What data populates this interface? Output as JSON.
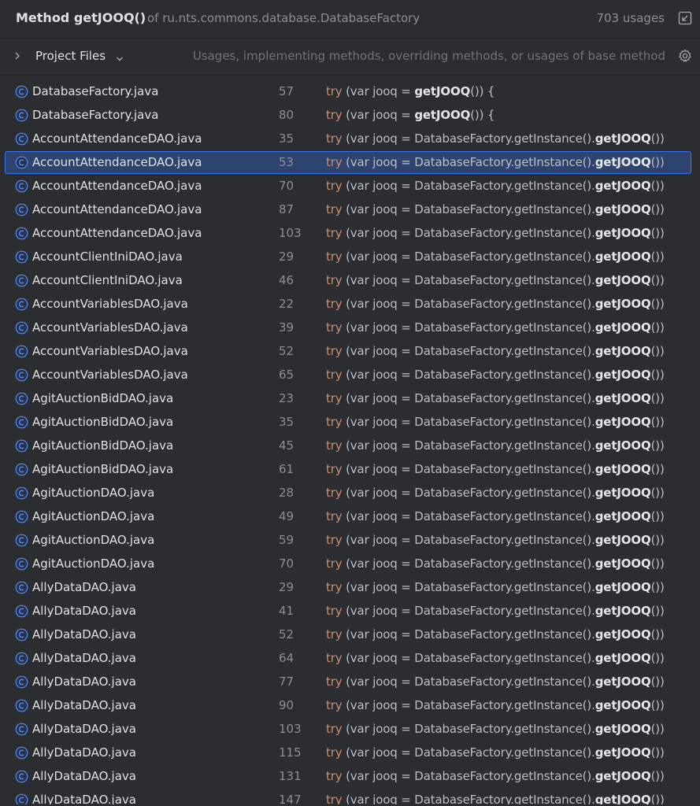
{
  "header": {
    "title": "Method getJOOQ()",
    "of_text": "of ru.nts.commons.database.DatabaseFactory",
    "usages": "703 usages",
    "expand_icon": "expand-icon"
  },
  "toolbar": {
    "scope": "Project Files",
    "filter_text": "Usages, implementing methods, overriding methods, or usages of base method",
    "gear_icon": "gear-icon"
  },
  "rows": [
    {
      "file": "DatabaseFactory.java",
      "line": "57",
      "kw": "try",
      "pre": " (var jooq = ",
      "hl": "getJOOQ",
      "post": "()) {"
    },
    {
      "file": "DatabaseFactory.java",
      "line": "80",
      "kw": "try",
      "pre": " (var jooq = ",
      "hl": "getJOOQ",
      "post": "()) {"
    },
    {
      "file": "AccountAttendanceDAO.java",
      "line": "35",
      "kw": "try",
      "pre": " (var jooq = DatabaseFactory.getInstance().",
      "hl": "getJOOQ",
      "post": "())"
    },
    {
      "file": "AccountAttendanceDAO.java",
      "line": "53",
      "kw": "try",
      "pre": " (var jooq = DatabaseFactory.getInstance().",
      "hl": "getJOOQ",
      "post": "())",
      "selected": true
    },
    {
      "file": "AccountAttendanceDAO.java",
      "line": "70",
      "kw": "try",
      "pre": " (var jooq = DatabaseFactory.getInstance().",
      "hl": "getJOOQ",
      "post": "())"
    },
    {
      "file": "AccountAttendanceDAO.java",
      "line": "87",
      "kw": "try",
      "pre": " (var jooq = DatabaseFactory.getInstance().",
      "hl": "getJOOQ",
      "post": "())"
    },
    {
      "file": "AccountAttendanceDAO.java",
      "line": "103",
      "kw": "try",
      "pre": " (var jooq = DatabaseFactory.getInstance().",
      "hl": "getJOOQ",
      "post": "())"
    },
    {
      "file": "AccountClientIniDAO.java",
      "line": "29",
      "kw": "try",
      "pre": " (var jooq = DatabaseFactory.getInstance().",
      "hl": "getJOOQ",
      "post": "())"
    },
    {
      "file": "AccountClientIniDAO.java",
      "line": "46",
      "kw": "try",
      "pre": " (var jooq = DatabaseFactory.getInstance().",
      "hl": "getJOOQ",
      "post": "())"
    },
    {
      "file": "AccountVariablesDAO.java",
      "line": "22",
      "kw": "try",
      "pre": " (var jooq = DatabaseFactory.getInstance().",
      "hl": "getJOOQ",
      "post": "())"
    },
    {
      "file": "AccountVariablesDAO.java",
      "line": "39",
      "kw": "try",
      "pre": " (var jooq = DatabaseFactory.getInstance().",
      "hl": "getJOOQ",
      "post": "())"
    },
    {
      "file": "AccountVariablesDAO.java",
      "line": "52",
      "kw": "try",
      "pre": " (var jooq = DatabaseFactory.getInstance().",
      "hl": "getJOOQ",
      "post": "())"
    },
    {
      "file": "AccountVariablesDAO.java",
      "line": "65",
      "kw": "try",
      "pre": " (var jooq = DatabaseFactory.getInstance().",
      "hl": "getJOOQ",
      "post": "())"
    },
    {
      "file": "AgitAuctionBidDAO.java",
      "line": "23",
      "kw": "try",
      "pre": " (var jooq = DatabaseFactory.getInstance().",
      "hl": "getJOOQ",
      "post": "())"
    },
    {
      "file": "AgitAuctionBidDAO.java",
      "line": "35",
      "kw": "try",
      "pre": " (var jooq = DatabaseFactory.getInstance().",
      "hl": "getJOOQ",
      "post": "())"
    },
    {
      "file": "AgitAuctionBidDAO.java",
      "line": "45",
      "kw": "try",
      "pre": " (var jooq = DatabaseFactory.getInstance().",
      "hl": "getJOOQ",
      "post": "())"
    },
    {
      "file": "AgitAuctionBidDAO.java",
      "line": "61",
      "kw": "try",
      "pre": " (var jooq = DatabaseFactory.getInstance().",
      "hl": "getJOOQ",
      "post": "())"
    },
    {
      "file": "AgitAuctionDAO.java",
      "line": "28",
      "kw": "try",
      "pre": " (var jooq = DatabaseFactory.getInstance().",
      "hl": "getJOOQ",
      "post": "())"
    },
    {
      "file": "AgitAuctionDAO.java",
      "line": "49",
      "kw": "try",
      "pre": " (var jooq = DatabaseFactory.getInstance().",
      "hl": "getJOOQ",
      "post": "())"
    },
    {
      "file": "AgitAuctionDAO.java",
      "line": "59",
      "kw": "try",
      "pre": " (var jooq = DatabaseFactory.getInstance().",
      "hl": "getJOOQ",
      "post": "())"
    },
    {
      "file": "AgitAuctionDAO.java",
      "line": "70",
      "kw": "try",
      "pre": " (var jooq = DatabaseFactory.getInstance().",
      "hl": "getJOOQ",
      "post": "())"
    },
    {
      "file": "AllyDataDAO.java",
      "line": "29",
      "kw": "try",
      "pre": " (var jooq = DatabaseFactory.getInstance().",
      "hl": "getJOOQ",
      "post": "())"
    },
    {
      "file": "AllyDataDAO.java",
      "line": "41",
      "kw": "try",
      "pre": " (var jooq = DatabaseFactory.getInstance().",
      "hl": "getJOOQ",
      "post": "())"
    },
    {
      "file": "AllyDataDAO.java",
      "line": "52",
      "kw": "try",
      "pre": " (var jooq = DatabaseFactory.getInstance().",
      "hl": "getJOOQ",
      "post": "())"
    },
    {
      "file": "AllyDataDAO.java",
      "line": "64",
      "kw": "try",
      "pre": " (var jooq = DatabaseFactory.getInstance().",
      "hl": "getJOOQ",
      "post": "())"
    },
    {
      "file": "AllyDataDAO.java",
      "line": "77",
      "kw": "try",
      "pre": " (var jooq = DatabaseFactory.getInstance().",
      "hl": "getJOOQ",
      "post": "())"
    },
    {
      "file": "AllyDataDAO.java",
      "line": "90",
      "kw": "try",
      "pre": " (var jooq = DatabaseFactory.getInstance().",
      "hl": "getJOOQ",
      "post": "())"
    },
    {
      "file": "AllyDataDAO.java",
      "line": "103",
      "kw": "try",
      "pre": " (var jooq = DatabaseFactory.getInstance().",
      "hl": "getJOOQ",
      "post": "())"
    },
    {
      "file": "AllyDataDAO.java",
      "line": "115",
      "kw": "try",
      "pre": " (var jooq = DatabaseFactory.getInstance().",
      "hl": "getJOOQ",
      "post": "())"
    },
    {
      "file": "AllyDataDAO.java",
      "line": "131",
      "kw": "try",
      "pre": " (var jooq = DatabaseFactory.getInstance().",
      "hl": "getJOOQ",
      "post": "())"
    },
    {
      "file": "AllyDataDAO.java",
      "line": "147",
      "kw": "try",
      "pre": " (var jooq = DatabaseFactory.getInstance().",
      "hl": "getJOOQ",
      "post": "())",
      "partial": true
    }
  ],
  "colors": {
    "background": "#2b2d30",
    "selection": "#2e436e",
    "keyword": "#cf8e6d",
    "class_icon": "#548af7"
  }
}
